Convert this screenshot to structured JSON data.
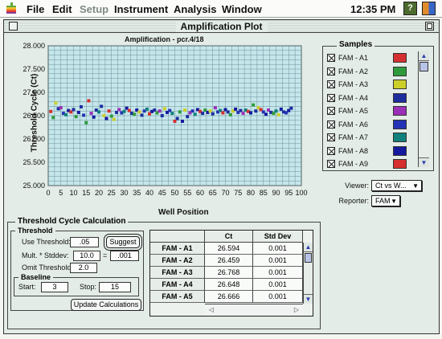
{
  "menubar": {
    "items": [
      {
        "label": "File",
        "dim": false
      },
      {
        "label": "Edit",
        "dim": false
      },
      {
        "label": "Setup",
        "dim": true
      },
      {
        "label": "Instrument",
        "dim": false
      },
      {
        "label": "Analysis",
        "dim": false
      },
      {
        "label": "Window",
        "dim": false
      }
    ],
    "clock": "12:35 PM",
    "help_icon": "help-balloon-icon",
    "finder_icon": "finder-icon",
    "apple_icon": "apple-icon"
  },
  "window": {
    "title": "Amplification Plot"
  },
  "chart_data": {
    "type": "scatter",
    "title": "Amplification - pcr.4/18",
    "xlabel": "Well Position",
    "ylabel": "Threshold Cycle (Ct)",
    "xlim": [
      0,
      100
    ],
    "ylim": [
      25.0,
      28.0
    ],
    "xticks": [
      "0",
      "5",
      "10",
      "15",
      "20",
      "25",
      "30",
      "35",
      "40",
      "45",
      "50",
      "55",
      "60",
      "65",
      "70",
      "75",
      "80",
      "85",
      "90",
      "95",
      "100"
    ],
    "yticks": [
      "25.000",
      "25.500",
      "26.000",
      "26.500",
      "27.000",
      "27.500",
      "28.000"
    ],
    "grid": true,
    "points": [
      {
        "x": 1,
        "y": 26.59,
        "color": "#d62f2f"
      },
      {
        "x": 2,
        "y": 26.46,
        "color": "#2e9a3c"
      },
      {
        "x": 3,
        "y": 26.77,
        "color": "#cccf2a"
      },
      {
        "x": 4,
        "y": 26.65,
        "color": "#1d2d9e"
      },
      {
        "x": 5,
        "y": 26.67,
        "color": "#9a2fb8"
      },
      {
        "x": 6,
        "y": 26.55,
        "color": "#2433b5"
      },
      {
        "x": 7,
        "y": 26.52,
        "color": "#12807c"
      },
      {
        "x": 8,
        "y": 26.61,
        "color": "#14199e"
      },
      {
        "x": 9,
        "y": 26.58,
        "color": "#d62f2f"
      },
      {
        "x": 10,
        "y": 26.63,
        "color": "#1d2d9e"
      },
      {
        "x": 11,
        "y": 26.48,
        "color": "#2e9a3c"
      },
      {
        "x": 12,
        "y": 26.57,
        "color": "#14199e"
      },
      {
        "x": 13,
        "y": 26.69,
        "color": "#1d2d9e"
      },
      {
        "x": 14,
        "y": 26.51,
        "color": "#2433b5"
      },
      {
        "x": 15,
        "y": 26.35,
        "color": "#2e9a3c"
      },
      {
        "x": 16,
        "y": 26.82,
        "color": "#d62f2f"
      },
      {
        "x": 17,
        "y": 26.55,
        "color": "#9a2fb8"
      },
      {
        "x": 18,
        "y": 26.47,
        "color": "#14199e"
      },
      {
        "x": 19,
        "y": 26.62,
        "color": "#1d2d9e"
      },
      {
        "x": 20,
        "y": 26.58,
        "color": "#12807c"
      },
      {
        "x": 21,
        "y": 26.7,
        "color": "#1d2d9e"
      },
      {
        "x": 22,
        "y": 26.5,
        "color": "#cccf2a"
      },
      {
        "x": 23,
        "y": 26.44,
        "color": "#14199e"
      },
      {
        "x": 24,
        "y": 26.6,
        "color": "#d62f2f"
      },
      {
        "x": 25,
        "y": 26.49,
        "color": "#2e9a3c"
      },
      {
        "x": 26,
        "y": 26.42,
        "color": "#cccf2a"
      },
      {
        "x": 27,
        "y": 26.57,
        "color": "#1d2d9e"
      },
      {
        "x": 28,
        "y": 26.63,
        "color": "#9a2fb8"
      },
      {
        "x": 29,
        "y": 26.56,
        "color": "#2433b5"
      },
      {
        "x": 30,
        "y": 26.59,
        "color": "#12807c"
      },
      {
        "x": 31,
        "y": 26.66,
        "color": "#14199e"
      },
      {
        "x": 32,
        "y": 26.61,
        "color": "#d62f2f"
      },
      {
        "x": 33,
        "y": 26.55,
        "color": "#1d2d9e"
      },
      {
        "x": 34,
        "y": 26.53,
        "color": "#2e9a3c"
      },
      {
        "x": 35,
        "y": 26.62,
        "color": "#14199e"
      },
      {
        "x": 36,
        "y": 26.58,
        "color": "#cccf2a"
      },
      {
        "x": 37,
        "y": 26.51,
        "color": "#1d2d9e"
      },
      {
        "x": 38,
        "y": 26.6,
        "color": "#2433b5"
      },
      {
        "x": 39,
        "y": 26.64,
        "color": "#12807c"
      },
      {
        "x": 40,
        "y": 26.54,
        "color": "#d62f2f"
      },
      {
        "x": 41,
        "y": 26.59,
        "color": "#14199e"
      },
      {
        "x": 42,
        "y": 26.62,
        "color": "#1d2d9e"
      },
      {
        "x": 43,
        "y": 26.56,
        "color": "#2e9a3c"
      },
      {
        "x": 44,
        "y": 26.6,
        "color": "#9a2fb8"
      },
      {
        "x": 45,
        "y": 26.5,
        "color": "#1d2d9e"
      },
      {
        "x": 46,
        "y": 26.65,
        "color": "#cccf2a"
      },
      {
        "x": 47,
        "y": 26.57,
        "color": "#14199e"
      },
      {
        "x": 48,
        "y": 26.61,
        "color": "#2433b5"
      },
      {
        "x": 49,
        "y": 26.55,
        "color": "#12807c"
      },
      {
        "x": 50,
        "y": 26.38,
        "color": "#d62f2f"
      },
      {
        "x": 51,
        "y": 26.44,
        "color": "#1d2d9e"
      },
      {
        "x": 52,
        "y": 26.58,
        "color": "#2e9a3c"
      },
      {
        "x": 53,
        "y": 26.38,
        "color": "#14199e"
      },
      {
        "x": 54,
        "y": 26.62,
        "color": "#cccf2a"
      },
      {
        "x": 55,
        "y": 26.48,
        "color": "#1d2d9e"
      },
      {
        "x": 56,
        "y": 26.56,
        "color": "#9a2fb8"
      },
      {
        "x": 57,
        "y": 26.6,
        "color": "#2433b5"
      },
      {
        "x": 58,
        "y": 26.53,
        "color": "#12807c"
      },
      {
        "x": 59,
        "y": 26.63,
        "color": "#14199e"
      },
      {
        "x": 60,
        "y": 26.59,
        "color": "#d62f2f"
      },
      {
        "x": 61,
        "y": 26.55,
        "color": "#1d2d9e"
      },
      {
        "x": 62,
        "y": 26.62,
        "color": "#2e9a3c"
      },
      {
        "x": 63,
        "y": 26.57,
        "color": "#14199e"
      },
      {
        "x": 64,
        "y": 26.6,
        "color": "#cccf2a"
      },
      {
        "x": 65,
        "y": 26.54,
        "color": "#1d2d9e"
      },
      {
        "x": 66,
        "y": 26.67,
        "color": "#9a2fb8"
      },
      {
        "x": 67,
        "y": 26.58,
        "color": "#2433b5"
      },
      {
        "x": 68,
        "y": 26.61,
        "color": "#12807c"
      },
      {
        "x": 69,
        "y": 26.56,
        "color": "#d62f2f"
      },
      {
        "x": 70,
        "y": 26.63,
        "color": "#14199e"
      },
      {
        "x": 71,
        "y": 26.58,
        "color": "#1d2d9e"
      },
      {
        "x": 72,
        "y": 26.52,
        "color": "#2e9a3c"
      },
      {
        "x": 73,
        "y": 26.6,
        "color": "#cccf2a"
      },
      {
        "x": 74,
        "y": 26.64,
        "color": "#14199e"
      },
      {
        "x": 75,
        "y": 26.57,
        "color": "#2433b5"
      },
      {
        "x": 76,
        "y": 26.61,
        "color": "#1d2d9e"
      },
      {
        "x": 77,
        "y": 26.55,
        "color": "#9a2fb8"
      },
      {
        "x": 78,
        "y": 26.62,
        "color": "#12807c"
      },
      {
        "x": 79,
        "y": 26.59,
        "color": "#d62f2f"
      },
      {
        "x": 80,
        "y": 26.56,
        "color": "#14199e"
      },
      {
        "x": 81,
        "y": 26.73,
        "color": "#2e9a3c"
      },
      {
        "x": 82,
        "y": 26.6,
        "color": "#1d2d9e"
      },
      {
        "x": 83,
        "y": 26.67,
        "color": "#cccf2a"
      },
      {
        "x": 84,
        "y": 26.63,
        "color": "#d62f2f"
      },
      {
        "x": 85,
        "y": 26.58,
        "color": "#2433b5"
      },
      {
        "x": 86,
        "y": 26.53,
        "color": "#14199e"
      },
      {
        "x": 87,
        "y": 26.62,
        "color": "#9a2fb8"
      },
      {
        "x": 88,
        "y": 26.57,
        "color": "#1d2d9e"
      },
      {
        "x": 89,
        "y": 26.55,
        "color": "#2e9a3c"
      },
      {
        "x": 90,
        "y": 26.6,
        "color": "#12807c"
      },
      {
        "x": 91,
        "y": 26.52,
        "color": "#cccf2a"
      },
      {
        "x": 92,
        "y": 26.64,
        "color": "#14199e"
      },
      {
        "x": 93,
        "y": 26.58,
        "color": "#1d2d9e"
      },
      {
        "x": 94,
        "y": 26.56,
        "color": "#2433b5"
      },
      {
        "x": 95,
        "y": 26.61,
        "color": "#14199e"
      },
      {
        "x": 96,
        "y": 26.66,
        "color": "#1d2d9e"
      }
    ]
  },
  "samples": {
    "title": "Samples",
    "items": [
      {
        "label": "FAM - A1",
        "color": "#d62f2f",
        "checked": true
      },
      {
        "label": "FAM - A2",
        "color": "#2e9a3c",
        "checked": true
      },
      {
        "label": "FAM - A3",
        "color": "#cccf2a",
        "checked": true
      },
      {
        "label": "FAM - A4",
        "color": "#1d2d9e",
        "checked": true
      },
      {
        "label": "FAM - A5",
        "color": "#9a2fb8",
        "checked": true
      },
      {
        "label": "FAM - A6",
        "color": "#2433b5",
        "checked": true
      },
      {
        "label": "FAM - A7",
        "color": "#12807c",
        "checked": true
      },
      {
        "label": "FAM - A8",
        "color": "#14199e",
        "checked": true
      },
      {
        "label": "FAM - A9",
        "color": "#d62f2f",
        "checked": true
      }
    ]
  },
  "viewer": {
    "label": "Viewer:",
    "value": "Ct vs W..."
  },
  "reporter": {
    "label": "Reporter:",
    "value": "FAM"
  },
  "calc": {
    "title": "Threshold Cycle Calculation",
    "threshold_title": "Threshold",
    "use_threshold_label": "Use Threshold:",
    "use_threshold_value": ".05",
    "suggest_label": "Suggest",
    "mult_label": "Mult. * Stddev:",
    "mult_value": "10.0",
    "mult_op": "=",
    "mult_result": ".001",
    "omit_label": "Omit Threshold:",
    "omit_value": "2.0",
    "baseline_title": "Baseline",
    "start_label": "Start:",
    "start_value": "3",
    "stop_label": "Stop:",
    "stop_value": "15",
    "update_label": "Update Calculations"
  },
  "table": {
    "headers": [
      "",
      "Ct",
      "Std Dev"
    ],
    "rows": [
      {
        "name": "FAM - A1",
        "ct": "26.594",
        "sd": "0.001"
      },
      {
        "name": "FAM - A2",
        "ct": "26.459",
        "sd": "0.001"
      },
      {
        "name": "FAM - A3",
        "ct": "26.768",
        "sd": "0.001"
      },
      {
        "name": "FAM - A4",
        "ct": "26.648",
        "sd": "0.001"
      },
      {
        "name": "FAM - A5",
        "ct": "26.666",
        "sd": "0.001"
      }
    ]
  }
}
